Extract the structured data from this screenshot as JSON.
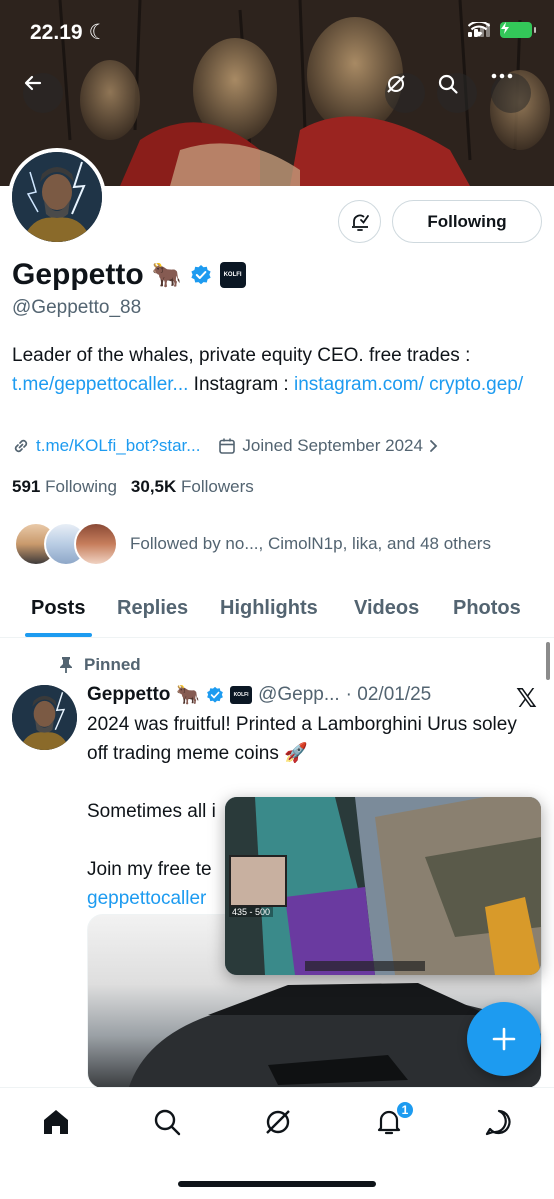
{
  "status_bar": {
    "time": "22.19"
  },
  "profile": {
    "name": "Geppetto",
    "name_emoji": "🐂",
    "badge_text": "KOLFI",
    "handle": "@Geppetto_88",
    "bio_text_1": "Leader of the whales, private equity CEO. free trades : ",
    "bio_link_1": "t.me/geppettocaller...",
    "bio_text_2": " Instagram : ",
    "bio_link_2": "instagram.com/ crypto.gep/",
    "website": "t.me/KOLfi_bot?star...",
    "joined": "Joined September 2024",
    "following_count": "591",
    "following_label": "Following",
    "followers_count": "30,5K",
    "followers_label": "Followers",
    "followed_by": "Followed by no..., CimolN1p, lika, and 48 others"
  },
  "actions": {
    "following_button": "Following"
  },
  "tabs": [
    {
      "label": "Posts",
      "active": true
    },
    {
      "label": "Replies"
    },
    {
      "label": "Highlights"
    },
    {
      "label": "Videos"
    },
    {
      "label": "Photos"
    }
  ],
  "post": {
    "pinned_label": "Pinned",
    "author": "Geppetto",
    "author_emoji": "🐂",
    "handle": "@Gepp...",
    "date": "· 02/01/25",
    "x_logo": "𝕏",
    "line_1": "2024 was fruitful! Printed a Lamborghini Urus soley off trading meme coins 🚀",
    "line_2": "Sometimes all i",
    "line_3": "Join my free te",
    "line_4_link": "geppettocaller"
  },
  "pip": {
    "overlay_text": "435 - 500"
  },
  "nav": {
    "notification_count": "1"
  },
  "colors": {
    "accent": "#1d9bf0",
    "text": "#0f1419",
    "secondary": "#536471"
  }
}
